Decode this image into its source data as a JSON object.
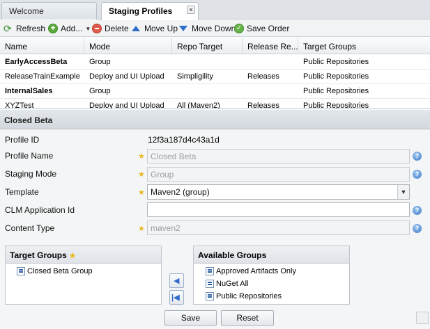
{
  "tabs": {
    "welcome": "Welcome",
    "staging": "Staging Profiles",
    "close": "×"
  },
  "toolbar": {
    "refresh": "Refresh",
    "add": "Add...",
    "delete": "Delete",
    "move_up": "Move Up",
    "move_down": "Move Down",
    "save_order": "Save Order"
  },
  "grid": {
    "columns": [
      "Name",
      "Mode",
      "Repo Target",
      "Release Re...",
      "Target Groups"
    ],
    "rows": [
      [
        "EarlyAccessBeta",
        "Group",
        "",
        "",
        "Public Repositories"
      ],
      [
        "ReleaseTrainExample",
        "Deploy and UI Upload",
        "Simpligility",
        "Releases",
        "Public Repositories"
      ],
      [
        "InternalSales",
        "Group",
        "",
        "",
        "Public Repositories"
      ],
      [
        "XYZTest",
        "Deploy and UI Upload",
        "All (Maven2)",
        "Releases",
        "Public Repositories"
      ]
    ]
  },
  "panel": {
    "title": "Closed Beta"
  },
  "form": {
    "profile_id_label": "Profile ID",
    "profile_id_value": "12f3a187d4c43a1d",
    "profile_name_label": "Profile Name",
    "profile_name_value": "Closed Beta",
    "staging_mode_label": "Staging Mode",
    "staging_mode_value": "Group",
    "template_label": "Template",
    "template_value": "Maven2 (group)",
    "clm_label": "CLM Application Id",
    "clm_value": "",
    "content_type_label": "Content Type",
    "content_type_value": "maven2"
  },
  "target_groups": {
    "title": "Target Groups",
    "items": [
      "Closed Beta Group"
    ]
  },
  "available_groups": {
    "title": "Available Groups",
    "items": [
      "Approved Artifacts Only",
      "NuGet All",
      "Public Repositories"
    ]
  },
  "buttons": {
    "save": "Save",
    "reset": "Reset"
  },
  "icons": {
    "star": "★",
    "help": "?",
    "dropdown": "▼",
    "move_left": "◀",
    "move_all_left": "|◀"
  }
}
